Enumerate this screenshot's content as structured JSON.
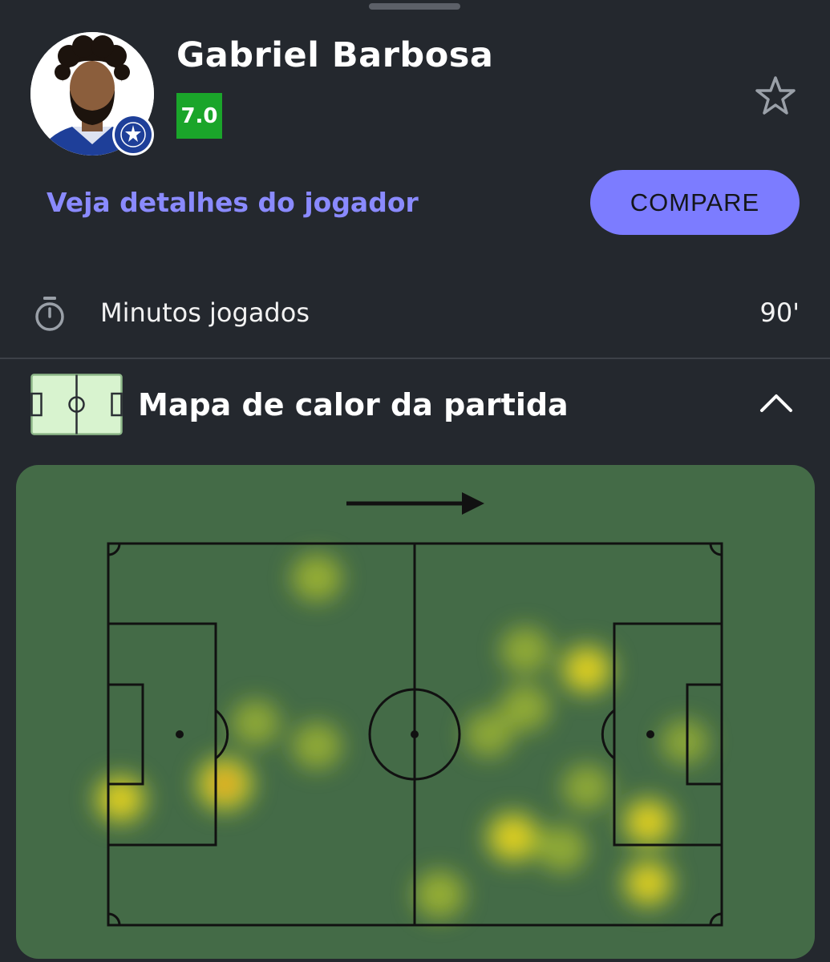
{
  "player": {
    "name": "Gabriel Barbosa",
    "rating": "7.0",
    "rating_color": "#1aa52a"
  },
  "actions": {
    "details_link": "Veja detalhes do jogador",
    "compare_label": "COMPARE",
    "accent_color": "#7c7cff"
  },
  "stats": {
    "minutes_label": "Minutos jogados",
    "minutes_value": "90'"
  },
  "heatmap": {
    "title": "Mapa de calor da partida",
    "attack_direction": "right",
    "pitch_color": "#446b47",
    "hotspots": [
      {
        "x": 34,
        "y": 9,
        "intensity": 0.55
      },
      {
        "x": 19,
        "y": 63,
        "intensity": 1.0
      },
      {
        "x": 2,
        "y": 67,
        "intensity": 0.75
      },
      {
        "x": 24,
        "y": 47,
        "intensity": 0.45
      },
      {
        "x": 34,
        "y": 53,
        "intensity": 0.5
      },
      {
        "x": 68,
        "y": 28,
        "intensity": 0.5
      },
      {
        "x": 78,
        "y": 33,
        "intensity": 0.8
      },
      {
        "x": 68,
        "y": 43,
        "intensity": 0.5
      },
      {
        "x": 62,
        "y": 50,
        "intensity": 0.45
      },
      {
        "x": 78,
        "y": 64,
        "intensity": 0.45
      },
      {
        "x": 88,
        "y": 73,
        "intensity": 0.75
      },
      {
        "x": 66,
        "y": 77,
        "intensity": 0.85
      },
      {
        "x": 74,
        "y": 80,
        "intensity": 0.5
      },
      {
        "x": 88,
        "y": 89,
        "intensity": 0.7
      },
      {
        "x": 54,
        "y": 92,
        "intensity": 0.55
      },
      {
        "x": 94,
        "y": 52,
        "intensity": 0.4
      }
    ]
  }
}
